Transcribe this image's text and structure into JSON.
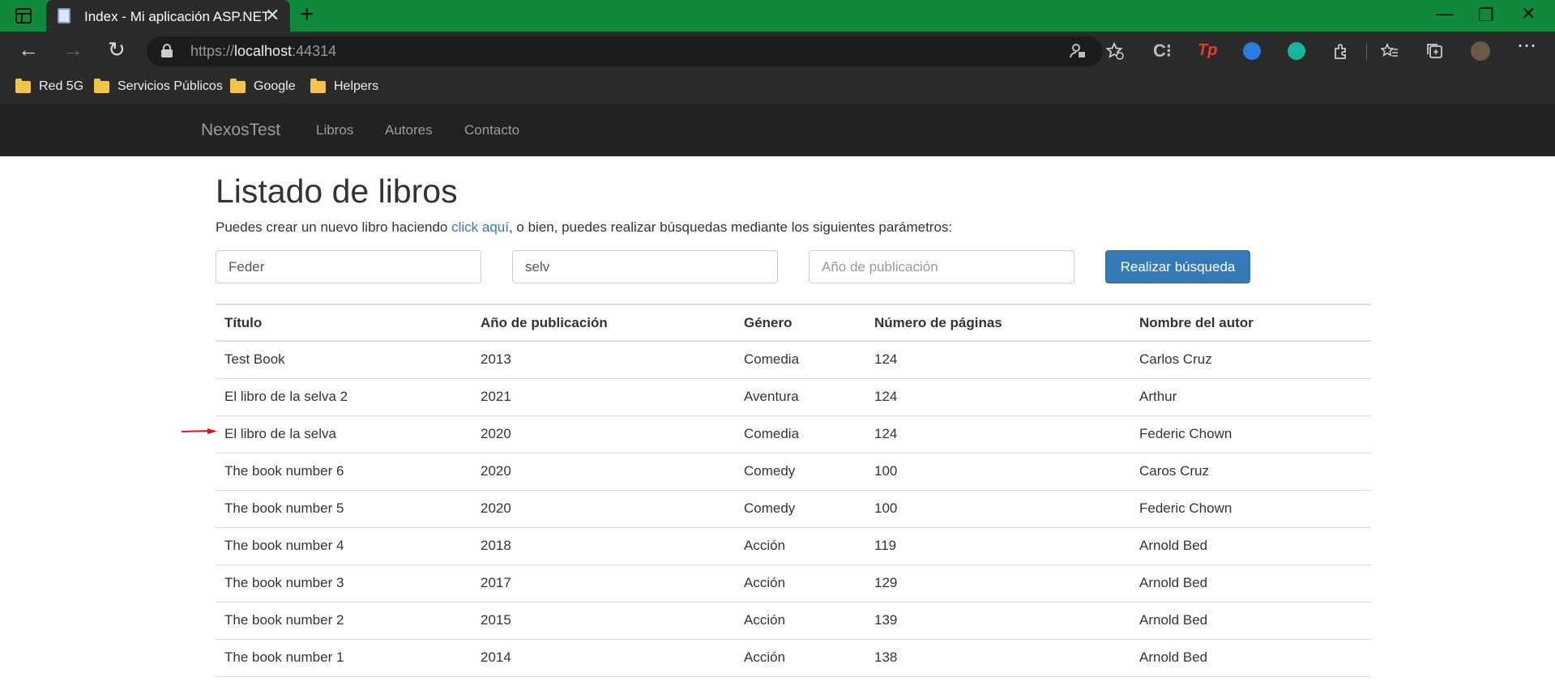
{
  "browser": {
    "tab_title": "Index - Mi aplicación ASP.NET",
    "url_scheme": "https://",
    "url_host": "localhost",
    "url_port": ":44314",
    "bookmarks": [
      "Red 5G",
      "Servicios Públicos",
      "Google",
      "Helpers"
    ]
  },
  "site": {
    "brand": "NexosTest",
    "nav": [
      "Libros",
      "Autores",
      "Contacto"
    ]
  },
  "page": {
    "title": "Listado de libros",
    "intro_before": "Puedes crear un nuevo libro haciendo ",
    "intro_link": "click aquí",
    "intro_after": ", o bien, puedes realizar búsquedas mediante los siguientes parámetros:"
  },
  "search": {
    "author_value": "Feder",
    "title_value": "selv",
    "year_placeholder": "Año de publicación",
    "year_value": "",
    "button_label": "Realizar búsqueda"
  },
  "table": {
    "headers": [
      "Título",
      "Año de publicación",
      "Género",
      "Número de páginas",
      "Nombre del autor"
    ],
    "rows": [
      [
        "Test Book",
        "2013",
        "Comedia",
        "124",
        "Carlos Cruz"
      ],
      [
        "El libro de la selva 2",
        "2021",
        "Aventura",
        "124",
        "Arthur"
      ],
      [
        "El libro de la selva",
        "2020",
        "Comedia",
        "124",
        "Federic Chown"
      ],
      [
        "The book number 6",
        "2020",
        "Comedy",
        "100",
        "Caros Cruz"
      ],
      [
        "The book number 5",
        "2020",
        "Comedy",
        "100",
        "Federic Chown"
      ],
      [
        "The book number 4",
        "2018",
        "Acción",
        "119",
        "Arnold Bed"
      ],
      [
        "The book number 3",
        "2017",
        "Acción",
        "129",
        "Arnold Bed"
      ],
      [
        "The book number 2",
        "2015",
        "Acción",
        "139",
        "Arnold Bed"
      ],
      [
        "The book number 1",
        "2014",
        "Acción",
        "138",
        "Arnold Bed"
      ]
    ]
  },
  "colors": {
    "titlebar": "#0f8a3c",
    "navbar": "#222222",
    "link": "#337ab7",
    "primary_button": "#337ab7",
    "annotation_arrow": "#e0141e"
  }
}
